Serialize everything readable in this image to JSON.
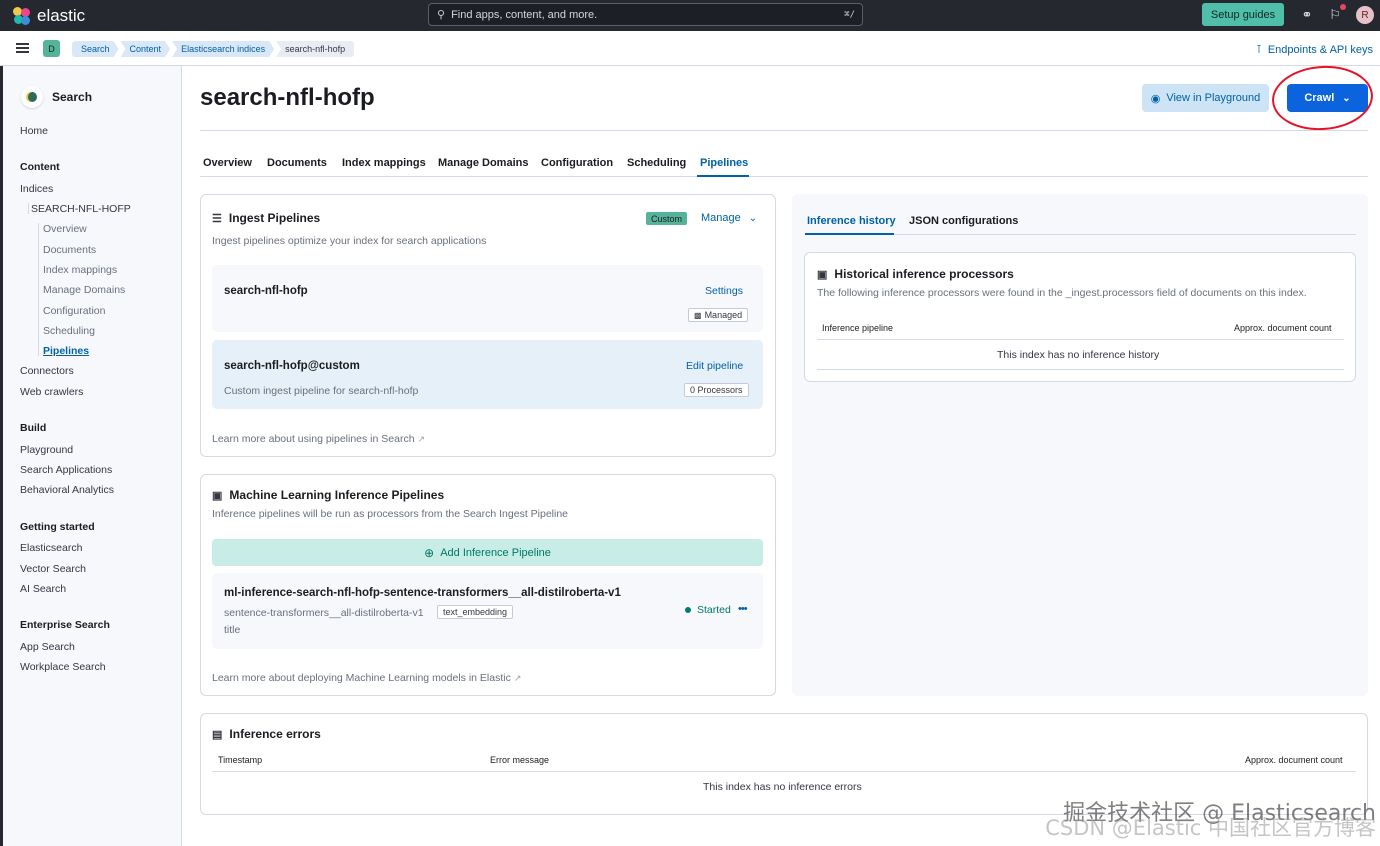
{
  "topbar": {
    "brand": "elastic",
    "search_placeholder": "Find apps, content, and more.",
    "search_shortcut": "⌘/",
    "setup_guides": "Setup guides",
    "avatar_initial": "R"
  },
  "header": {
    "space_initial": "D",
    "breadcrumbs": [
      "Search",
      "Content",
      "Elasticsearch indices",
      "search-nfl-hofp"
    ],
    "endpoints_label": "Endpoints & API keys"
  },
  "sidebar": {
    "title": "Search",
    "home": "Home",
    "content_heading": "Content",
    "indices": "Indices",
    "index_name": "SEARCH-NFL-HOFP",
    "index_subitems": [
      "Overview",
      "Documents",
      "Index mappings",
      "Manage Domains",
      "Configuration",
      "Scheduling",
      "Pipelines"
    ],
    "connectors": "Connectors",
    "web_crawlers": "Web crawlers",
    "build_heading": "Build",
    "build_items": [
      "Playground",
      "Search Applications",
      "Behavioral Analytics"
    ],
    "getting_started_heading": "Getting started",
    "getting_started_items": [
      "Elasticsearch",
      "Vector Search",
      "AI Search"
    ],
    "enterprise_heading": "Enterprise Search",
    "enterprise_items": [
      "App Search",
      "Workplace Search"
    ]
  },
  "page": {
    "title": "search-nfl-hofp",
    "view_in_playground": "View in Playground",
    "crawl": "Crawl",
    "tabs": [
      "Overview",
      "Documents",
      "Index mappings",
      "Manage Domains",
      "Configuration",
      "Scheduling",
      "Pipelines"
    ],
    "active_tab": "Pipelines"
  },
  "ingest": {
    "title": "Ingest Pipelines",
    "badge": "Custom",
    "manage": "Manage",
    "description": "Ingest pipelines optimize your index for search applications",
    "pipeline1": {
      "name": "search-nfl-hofp",
      "action": "Settings",
      "badge": "Managed"
    },
    "pipeline2": {
      "name": "search-nfl-hofp@custom",
      "action": "Edit pipeline",
      "description": "Custom ingest pipeline for search-nfl-hofp",
      "badge": "0 Processors"
    },
    "learn_more": "Learn more about using pipelines in Search"
  },
  "ml": {
    "title": "Machine Learning Inference Pipelines",
    "description": "Inference pipelines will be run as processors from the Search Ingest Pipeline",
    "add_button": "Add Inference Pipeline",
    "pipeline": {
      "name": "ml-inference-search-nfl-hofp-sentence-transformers__all-distilroberta-v1",
      "model": "sentence-transformers__all-distilroberta-v1",
      "type_badge": "text_embedding",
      "field": "title",
      "status": "Started",
      "more": "•••"
    },
    "learn_more": "Learn more about deploying Machine Learning models in Elastic"
  },
  "history": {
    "tabs": [
      "Inference history",
      "JSON configurations"
    ],
    "title": "Historical inference processors",
    "description": "The following inference processors were found in the _ingest.processors field of documents on this index.",
    "columns": [
      "Inference pipeline",
      "Approx. document count"
    ],
    "empty": "This index has no inference history"
  },
  "errors": {
    "title": "Inference errors",
    "columns": [
      "Timestamp",
      "Error message",
      "Approx. document count"
    ],
    "empty": "This index has no inference errors"
  },
  "watermark": {
    "line1": "掘金技术社区 @ Elasticsearch",
    "line2": "CSDN @Elastic 中国社区官方博客"
  },
  "colors": {
    "accent": "#0061a6",
    "primary_button": "#0b64dd",
    "success": "#007766",
    "annotation": "#e4122a"
  }
}
